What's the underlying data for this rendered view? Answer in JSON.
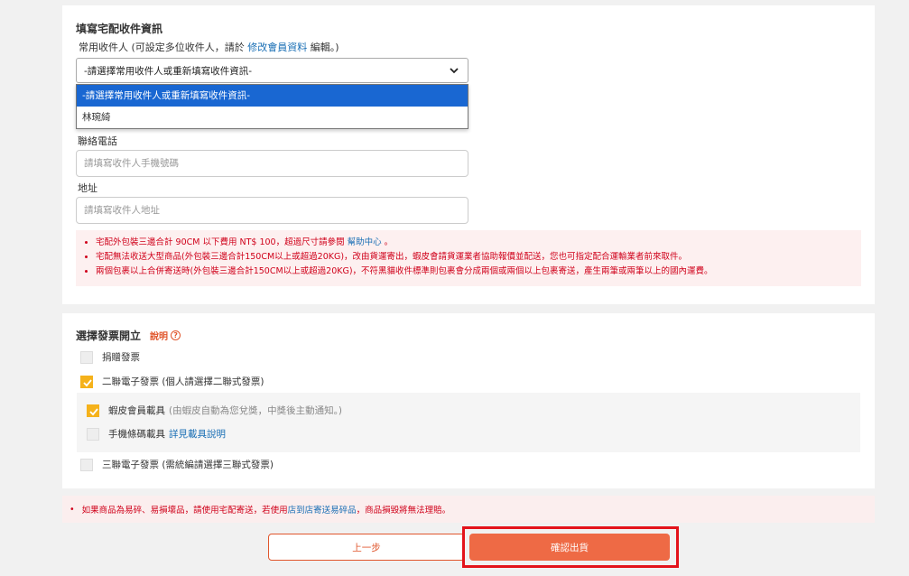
{
  "recipient_section": {
    "title": "填寫宅配收件資訊",
    "common_label_prefix": "常用收件人 (可設定多位收件人，請於",
    "common_label_link": "修改會員資料",
    "common_label_suffix": "編輯。)",
    "select_value": "-請選擇常用收件人或重新填寫收件資訊-",
    "dropdown_options": [
      "-請選擇常用收件人或重新填寫收件資訊-",
      "林琬綺"
    ],
    "phone_label": "聯絡電話",
    "phone_placeholder": "請填寫收件人手機號碼",
    "address_label": "地址",
    "address_placeholder": "請填寫收件人地址",
    "notices": {
      "n1_text": "宅配外包裝三邊合計 90CM 以下費用 NT$ 100，超過尺寸請參閱",
      "n1_link": "幫助中心",
      "n1_end": "。",
      "n2": "宅配無法收送大型商品(外包裝三邊合計150CM以上或超過20KG)，改由貨運寄出，蝦皮會請貨運業者協助報價並配送，您也可指定配合運輸業者前來取件。",
      "n3": "兩個包裹以上合併寄送時(外包裝三邊合計150CM以上或超過20KG)，不符黑貓收件標準則包裹會分成兩個或兩個以上包裹寄送，產生兩筆或兩筆以上的國內運費。"
    }
  },
  "invoice_section": {
    "title": "選擇發票開立",
    "help_label": "說明",
    "help_icon": "?",
    "donate_label": "捐贈發票",
    "two_part_label": "二聯電子發票 (個人請選擇二聯式發票)",
    "member_carrier_label": "蝦皮會員載具",
    "member_carrier_note": "(由蝦皮自動為您兌獎，中獎後主動通知。)",
    "mobile_carrier_label": "手機條碼載具",
    "mobile_carrier_link": "詳見載具說明",
    "three_part_label": "三聯電子發票 (需統編請選擇三聯式發票)"
  },
  "bottom_notice": {
    "bullet": "•",
    "prefix": "如果商品為易碎、易損壞品，請使用宅配寄送，若使用",
    "link": "店到店寄送易碎品",
    "suffix": "，商品損毀將無法理賠。"
  },
  "buttons": {
    "prev": "上一步",
    "confirm": "確認出貨"
  },
  "colors": {
    "accent": "#ee6a45",
    "checkbox_on": "#f5b21b",
    "warning": "#d0021b",
    "link": "#1a6fb5",
    "highlight_frame": "#e3131b"
  }
}
